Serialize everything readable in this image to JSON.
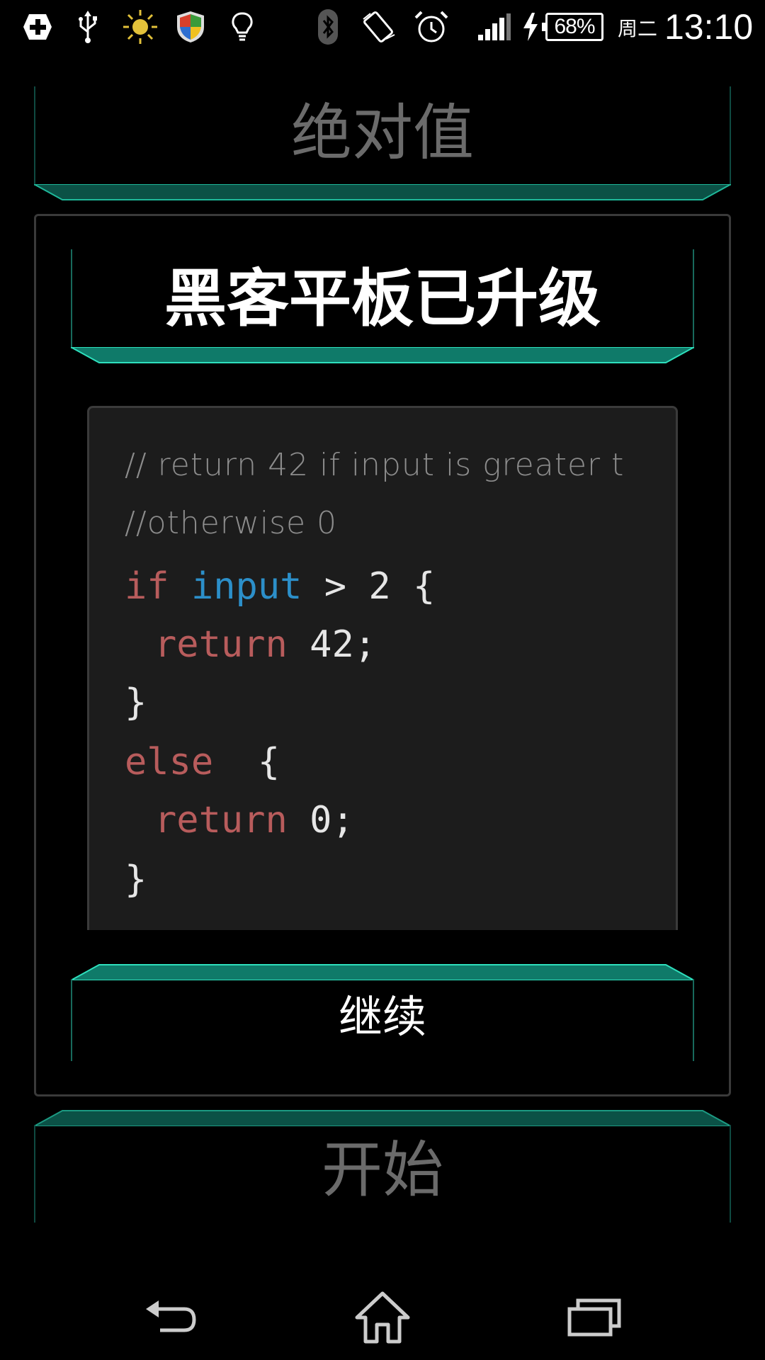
{
  "status_bar": {
    "icons": [
      "medical-plus-icon",
      "usb-icon",
      "sun-icon",
      "shield-icon",
      "lightbulb-icon",
      "bluetooth-icon",
      "screen-rotate-icon",
      "alarm-clock-icon",
      "signal-icon",
      "charging-bolt-icon",
      "battery-icon"
    ],
    "battery_percent": "68%",
    "day": "周二",
    "time": "13:10"
  },
  "panels": {
    "absolute_value": "绝对值",
    "start": "开始"
  },
  "dialog": {
    "title": "黑客平板已升级",
    "continue_label": "继续",
    "code": {
      "comment_1": "// return 42 if input is greater t",
      "comment_2": "//otherwise 0",
      "line_if_kw": "if",
      "line_if_id": "input",
      "line_if_rest": " > 2 {",
      "line_ret1_kw": "return",
      "line_ret1_rest": " 42;",
      "close_1": "}",
      "line_else_kw": "else",
      "line_else_rest": "  {",
      "line_ret2_kw": "return",
      "line_ret2_rest": " 0;",
      "close_2": "}"
    }
  },
  "nav_bar": {
    "icons": [
      "back-icon",
      "home-icon",
      "recents-icon"
    ]
  },
  "colors": {
    "accent_teal": "#1fb89a",
    "keyword": "#b85c5c",
    "identifier": "#2c8fc9",
    "code_bg": "#1c1c1c"
  }
}
